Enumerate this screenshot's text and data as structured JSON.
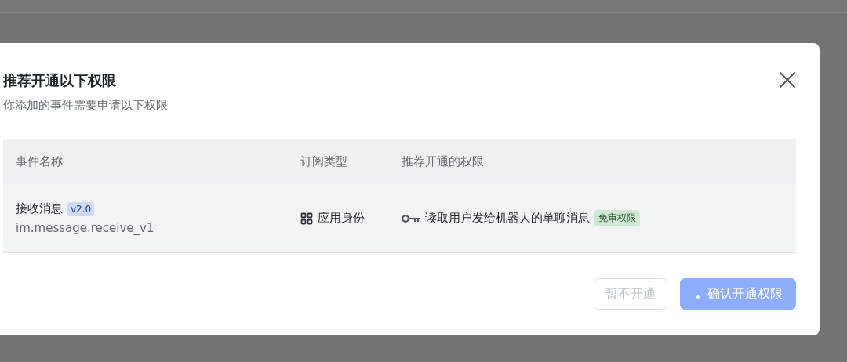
{
  "dialog": {
    "title": "推荐开通以下权限",
    "subtitle": "你添加的事件需要申请以下权限",
    "table": {
      "columns": [
        "事件名称",
        "订阅类型",
        "推荐开通的权限"
      ],
      "rows": [
        {
          "event_name": "接收消息",
          "version": "v2.0",
          "event_key": "im.message.receive_v1",
          "subscription_type": "应用身份",
          "permission": "读取用户发给机器人的单聊消息",
          "permission_badge": "免审权限"
        }
      ]
    },
    "buttons": [
      {
        "label": "暂不开通",
        "kind": "secondary",
        "disabled": true
      },
      {
        "label": "确认开通权限",
        "kind": "primary",
        "disabled": true,
        "loading": true
      }
    ]
  }
}
